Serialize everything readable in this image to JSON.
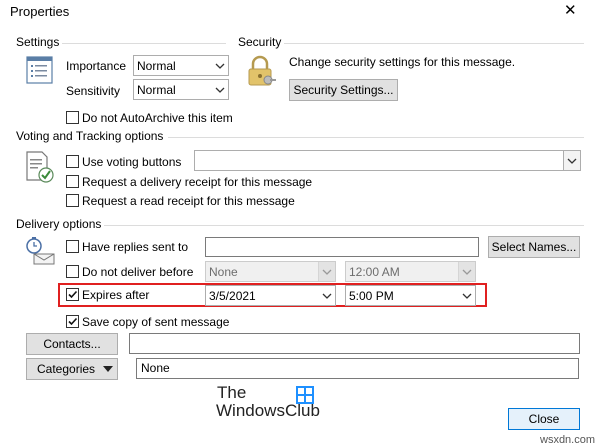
{
  "window": {
    "title": "Properties",
    "close_glyph": "✕"
  },
  "settings": {
    "header": "Settings",
    "importance_label": "Importance",
    "importance_value": "Normal",
    "sensitivity_label": "Sensitivity",
    "sensitivity_value": "Normal",
    "autoarchive_label": "Do not AutoArchive this item",
    "autoarchive_checked": false
  },
  "security": {
    "header": "Security",
    "description": "Change security settings for this message.",
    "button_label": "Security Settings..."
  },
  "voting": {
    "header": "Voting and Tracking options",
    "use_voting_label": "Use voting buttons",
    "use_voting_checked": false,
    "voting_value": "",
    "delivery_receipt_label": "Request a delivery receipt for this message",
    "delivery_receipt_checked": false,
    "read_receipt_label": "Request a read receipt for this message",
    "read_receipt_checked": false
  },
  "delivery": {
    "header": "Delivery options",
    "replies_label": "Have replies sent to",
    "replies_checked": false,
    "replies_value": "",
    "select_names_label": "Select Names...",
    "do_not_deliver_label": "Do not deliver before",
    "do_not_deliver_checked": false,
    "do_not_deliver_date": "None",
    "do_not_deliver_time": "12:00 AM",
    "expires_label": "Expires after",
    "expires_checked": true,
    "expires_date": "3/5/2021",
    "expires_time": "5:00 PM",
    "save_copy_label": "Save copy of sent message",
    "save_copy_checked": true
  },
  "contacts": {
    "button_label": "Contacts...",
    "value": ""
  },
  "categories": {
    "button_label": "Categories",
    "value": "None"
  },
  "watermark": {
    "line1": "The",
    "line2": "WindowsClub"
  },
  "footer": {
    "close_label": "Close",
    "site": "wsxdn.com"
  },
  "colors": {
    "highlight_box": "#e02020",
    "default_button_border": "#0078d7",
    "default_button_bg": "#e5f1fb"
  }
}
